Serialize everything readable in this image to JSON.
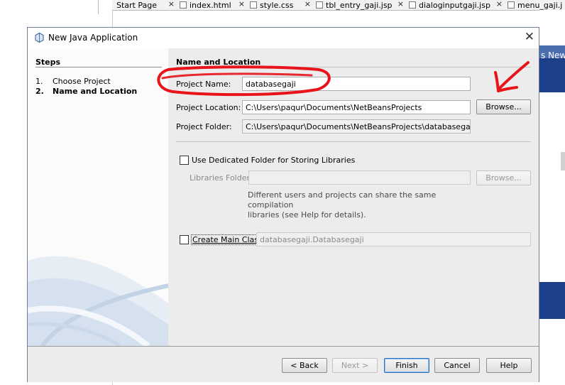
{
  "ide": {
    "tabs": [
      {
        "label": "Start Page"
      },
      {
        "label": "index.html"
      },
      {
        "label": "style.css"
      },
      {
        "label": "tbl_entry_gaji.jsp"
      },
      {
        "label": "dialoginputgaji.jsp"
      },
      {
        "label": "menu_gaji.j"
      }
    ],
    "close_glyph": "×",
    "right_banner_text": "s New"
  },
  "dialog": {
    "title": "New Java Application",
    "close_glyph": "✕",
    "app_icon": "java-cup-icon"
  },
  "steps": {
    "heading": "Steps",
    "items": [
      {
        "num": "1.",
        "label": "Choose Project"
      },
      {
        "num": "2.",
        "label": "Name and Location"
      }
    ]
  },
  "form": {
    "section_title": "Name and Location",
    "project_name": {
      "label": "Project Name:",
      "value": "databasegaji"
    },
    "project_location": {
      "label": "Project Location:",
      "value": "C:\\Users\\paqur\\Documents\\NetBeansProjects",
      "browse": "Browse..."
    },
    "project_folder": {
      "label": "Project Folder:",
      "value": "C:\\Users\\paqur\\Documents\\NetBeansProjects\\databasegaji"
    },
    "dedicated_folder": {
      "label": "Use Dedicated Folder for Storing Libraries",
      "checked": false
    },
    "libraries_folder": {
      "label": "Libraries Folder:",
      "value": "",
      "browse": "Browse..."
    },
    "help_text_line1": "Different users and projects can share the same compilation",
    "help_text_line2": "libraries (see Help for details).",
    "main_class": {
      "label": "Create Main Class",
      "checked": false,
      "value": "databasegaji.Databasegaji"
    }
  },
  "buttons": {
    "back": "< Back",
    "next": "Next >",
    "finish": "Finish",
    "cancel": "Cancel",
    "help": "Help"
  },
  "colors": {
    "annotation": "#e8131b",
    "dialog_border": "#6f7f9a",
    "content_bg": "#ececec",
    "default_button_border": "#2c6fbf"
  }
}
